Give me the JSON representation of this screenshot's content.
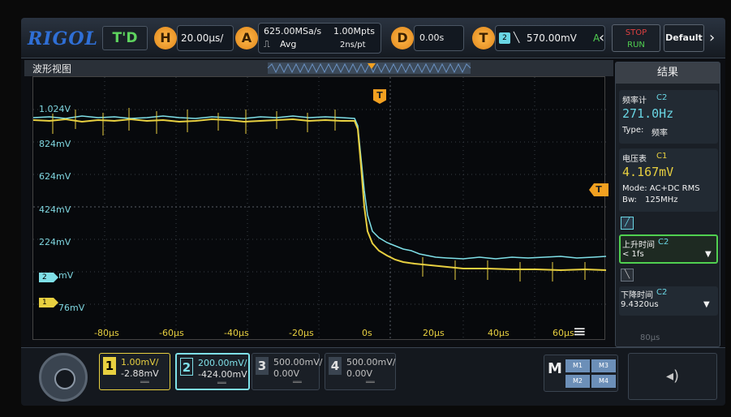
{
  "toolbar": {
    "logo": "RIGOL",
    "trigger_status": "T'D",
    "horizontal_key": "H",
    "timebase": "20.00μs/",
    "acquire_key": "A",
    "sample_rate": "625.00MSa/s",
    "memory_depth": "1.00Mpts",
    "acquire_mode": "Avg",
    "sample_interval": "2ns/pt",
    "delay_key": "D",
    "delay_value": "0.00s",
    "trigger_key": "T",
    "trigger_source": "2",
    "trigger_level": "570.00mV",
    "trigger_mode": "A",
    "stop_label": "STOP",
    "run_label": "RUN",
    "default_label": "Default",
    "nav_left": "‹",
    "nav_right": "›"
  },
  "waveform": {
    "title": "波形视图",
    "y_labels": [
      "1.024V",
      "824mV",
      "624mV",
      "424mV",
      "224mV",
      "mV",
      "76mV"
    ],
    "x_labels": [
      "-80μs",
      "-60μs",
      "-40μs",
      "-20μs",
      "0s",
      "20μs",
      "40μs",
      "60μs"
    ],
    "ch1_marker": "1",
    "ch2_marker": "2",
    "trigger_marker": "T",
    "trigger_level_marker": "T",
    "menu_icon": "≡"
  },
  "results": {
    "title": "结果",
    "freq": {
      "label": "频率计",
      "channel": "C2",
      "value": "271.0Hz",
      "type_label": "Type:",
      "type_value": "频率"
    },
    "volt": {
      "label": "电压表",
      "channel": "C1",
      "value": "4.167mV",
      "mode": "Mode: AC+DC RMS",
      "bw_label": "Bw:",
      "bw_value": "125MHz"
    },
    "rise": {
      "label": "上升时间",
      "channel": "C2",
      "value": "< 1fs"
    },
    "fall": {
      "label": "下降时间",
      "channel": "C2",
      "value": "9.4320us"
    },
    "ghost_x_label": "80μs"
  },
  "channels": [
    {
      "num": "1",
      "scale": "1.00mV/",
      "offset": "-2.88mV",
      "color": "#e8d040"
    },
    {
      "num": "2",
      "scale": "200.00mV/",
      "offset": "-424.00mV",
      "color": "#6ad6e4"
    },
    {
      "num": "3",
      "scale": "500.00mV/",
      "offset": "0.00V",
      "color": "#888888"
    },
    {
      "num": "4",
      "scale": "500.00mV/",
      "offset": "0.00V",
      "color": "#888888"
    }
  ],
  "math": {
    "key": "M",
    "m1": "M1",
    "m2": "M2",
    "m3": "M3",
    "m4": "M4"
  },
  "sound_icon": "speaker-icon",
  "colors": {
    "ch1": "#e8d040",
    "ch2": "#7fe0e8",
    "trigger": "#f2a020",
    "accent": "#2f6fd6"
  }
}
